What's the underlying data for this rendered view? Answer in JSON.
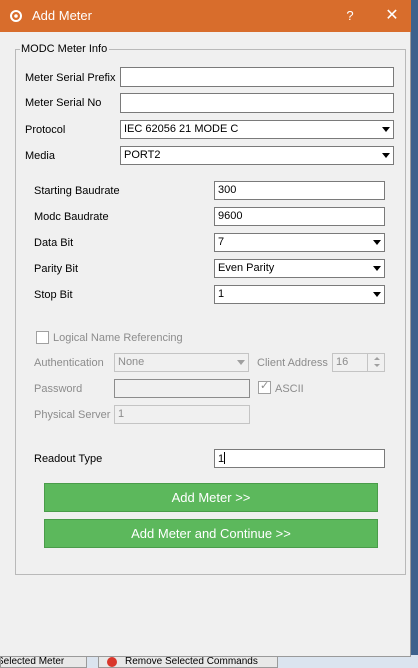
{
  "dialog": {
    "title": "Add Meter",
    "help_glyph": "?",
    "close_glyph": "✕",
    "group_title": "MODC Meter Info"
  },
  "fields": {
    "meter_serial_prefix": {
      "label": "Meter Serial Prefix",
      "value": ""
    },
    "meter_serial_no": {
      "label": "Meter Serial No",
      "value": ""
    },
    "protocol": {
      "label": "Protocol",
      "value": "IEC 62056 21 MODE C"
    },
    "media": {
      "label": "Media",
      "value": "PORT2"
    },
    "starting_baudrate": {
      "label": "Starting Baudrate",
      "value": "300"
    },
    "modc_baudrate": {
      "label": "Modc Baudrate",
      "value": "9600"
    },
    "data_bit": {
      "label": "Data Bit",
      "value": "7"
    },
    "parity_bit": {
      "label": "Parity Bit",
      "value": "Even Parity"
    },
    "stop_bit": {
      "label": "Stop Bit",
      "value": "1"
    },
    "logical_name_referencing": {
      "label": "Logical Name Referencing",
      "checked": false
    },
    "authentication": {
      "label": "Authentication",
      "value": "None"
    },
    "client_address": {
      "label": "Client Address",
      "value": "16"
    },
    "password": {
      "label": "Password",
      "value": ""
    },
    "ascii": {
      "label": "ASCII",
      "checked": true
    },
    "physical_server": {
      "label": "Physical Server",
      "value": "1"
    },
    "readout_type": {
      "label": "Readout Type",
      "value": "1"
    }
  },
  "buttons": {
    "add_meter": "Add Meter >>",
    "add_meter_continue": "Add Meter and Continue >>"
  },
  "background": {
    "bottom_left_text": "Selected Meter",
    "bottom_right_text": "Remove Selected Commands"
  },
  "colors": {
    "titlebar": "#d86d2c",
    "button_green": "#5cb85c",
    "disabled_text": "#8c8c8c"
  }
}
